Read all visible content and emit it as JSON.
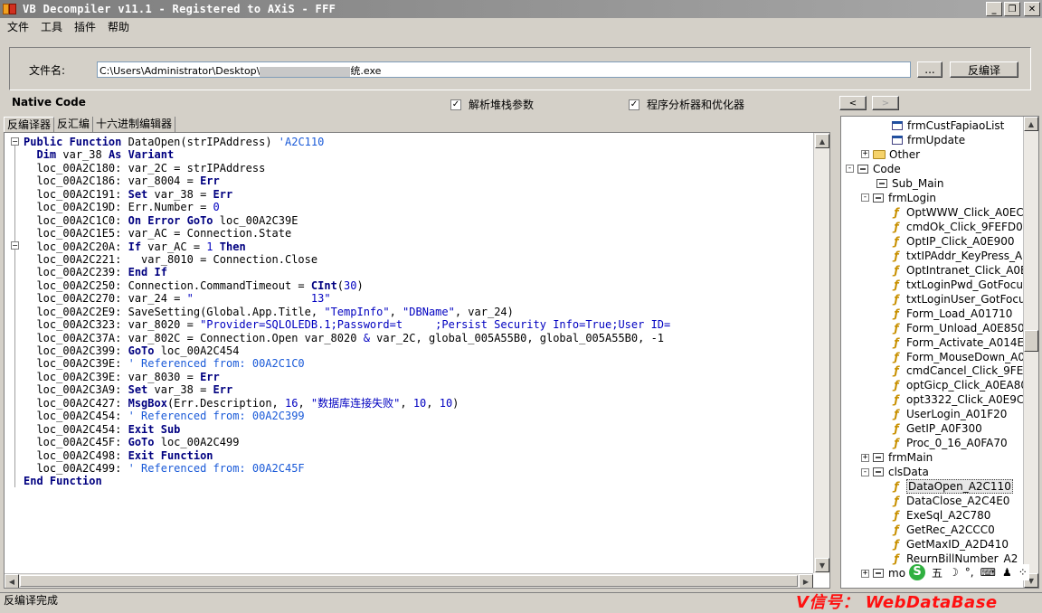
{
  "window": {
    "title": "VB Decompiler v11.1 - Registered to AXiS - FFF",
    "minimize": "_",
    "restore": "❐",
    "close": "✕"
  },
  "menu": [
    "文件",
    "工具",
    "插件",
    "帮助"
  ],
  "file": {
    "label": "文件名:",
    "path_prefix": "C:\\Users\\Administrator\\Desktop\\",
    "path_suffix": "统.exe",
    "browse_label": "...",
    "decompile_label": "反编译"
  },
  "options": {
    "native_label": "Native Code",
    "checkbox1": {
      "label": "解析堆栈参数",
      "checked": true
    },
    "checkbox2": {
      "label": "程序分析器和优化器",
      "checked": true
    },
    "back_label": "<",
    "forward_label": ">"
  },
  "tabs": [
    "反编译器",
    "反汇编",
    "十六进制编辑器"
  ],
  "code_lines": [
    [
      {
        "t": "Public Function",
        "c": "kw"
      },
      {
        "t": " DataOpen(strIPAddress) "
      },
      {
        "t": "'A2C110",
        "c": "cm"
      }
    ],
    [
      {
        "t": "  "
      },
      {
        "t": "Dim",
        "c": "kw"
      },
      {
        "t": " var_38 "
      },
      {
        "t": "As Variant",
        "c": "kw"
      }
    ],
    [
      {
        "t": "  loc_00A2C180: var_2C = strIPAddress"
      }
    ],
    [
      {
        "t": "  loc_00A2C186: var_8004 = "
      },
      {
        "t": "Err",
        "c": "kw"
      }
    ],
    [
      {
        "t": "  loc_00A2C191: "
      },
      {
        "t": "Set",
        "c": "kw"
      },
      {
        "t": " var_38 = "
      },
      {
        "t": "Err",
        "c": "kw"
      }
    ],
    [
      {
        "t": "  loc_00A2C19D: Err.Number = "
      },
      {
        "t": "0",
        "c": "str"
      }
    ],
    [
      {
        "t": "  loc_00A2C1C0: "
      },
      {
        "t": "On Error GoTo",
        "c": "kw"
      },
      {
        "t": " loc_00A2C39E"
      }
    ],
    [
      {
        "t": "  loc_00A2C1E5: var_AC = Connection.State"
      }
    ],
    [
      {
        "t": "  loc_00A2C20A: "
      },
      {
        "t": "If",
        "c": "kw"
      },
      {
        "t": " var_AC = "
      },
      {
        "t": "1",
        "c": "str"
      },
      {
        "t": " "
      },
      {
        "t": "Then",
        "c": "kw"
      }
    ],
    [
      {
        "t": "  loc_00A2C221:   var_8010 = Connection.Close"
      }
    ],
    [
      {
        "t": "  loc_00A2C239: "
      },
      {
        "t": "End If",
        "c": "kw"
      }
    ],
    [
      {
        "t": "  loc_00A2C250: Connection.CommandTimeout = "
      },
      {
        "t": "CInt",
        "c": "kw"
      },
      {
        "t": "("
      },
      {
        "t": "30",
        "c": "str"
      },
      {
        "t": ")"
      }
    ],
    [
      {
        "t": "  loc_00A2C270: var_24 = "
      },
      {
        "t": "\"                  13\"",
        "c": "str"
      }
    ],
    [
      {
        "t": "  loc_00A2C2E9: SaveSetting(Global.App.Title, "
      },
      {
        "t": "\"TempInfo\"",
        "c": "str"
      },
      {
        "t": ", "
      },
      {
        "t": "\"DBName\"",
        "c": "str"
      },
      {
        "t": ", var_24)"
      }
    ],
    [
      {
        "t": "  loc_00A2C323: var_8020 = "
      },
      {
        "t": "\"Provider=SQLOLEDB.1;Password=t     ;Persist Security Info=True;User ID=",
        "c": "str"
      }
    ],
    [
      {
        "t": "  loc_00A2C37A: var_802C = Connection.Open var_8020 "
      },
      {
        "t": "&",
        "c": "str"
      },
      {
        "t": " var_2C, global_005A55B0, global_005A55B0, -1"
      }
    ],
    [
      {
        "t": "  loc_00A2C399: "
      },
      {
        "t": "GoTo",
        "c": "kw"
      },
      {
        "t": " loc_00A2C454"
      }
    ],
    [
      {
        "t": "  loc_00A2C39E: "
      },
      {
        "t": "' Referenced from: 00A2C1C0",
        "c": "cm"
      }
    ],
    [
      {
        "t": "  loc_00A2C39E: var_8030 = "
      },
      {
        "t": "Err",
        "c": "kw"
      }
    ],
    [
      {
        "t": "  loc_00A2C3A9: "
      },
      {
        "t": "Set",
        "c": "kw"
      },
      {
        "t": " var_38 = "
      },
      {
        "t": "Err",
        "c": "kw"
      }
    ],
    [
      {
        "t": "  loc_00A2C427: "
      },
      {
        "t": "MsgBox",
        "c": "kw"
      },
      {
        "t": "(Err.Description, "
      },
      {
        "t": "16",
        "c": "str"
      },
      {
        "t": ", "
      },
      {
        "t": "\"数据库连接失败\"",
        "c": "str"
      },
      {
        "t": ", "
      },
      {
        "t": "10",
        "c": "str"
      },
      {
        "t": ", "
      },
      {
        "t": "10",
        "c": "str"
      },
      {
        "t": ")"
      }
    ],
    [
      {
        "t": "  loc_00A2C454: "
      },
      {
        "t": "' Referenced from: 00A2C399",
        "c": "cm"
      }
    ],
    [
      {
        "t": "  loc_00A2C454: "
      },
      {
        "t": "Exit Sub",
        "c": "kw"
      }
    ],
    [
      {
        "t": "  loc_00A2C45F: "
      },
      {
        "t": "GoTo",
        "c": "kw"
      },
      {
        "t": " loc_00A2C499"
      }
    ],
    [
      {
        "t": "  loc_00A2C498: "
      },
      {
        "t": "Exit Function",
        "c": "kw"
      }
    ],
    [
      {
        "t": "  loc_00A2C499: "
      },
      {
        "t": "' Referenced from: 00A2C45F",
        "c": "cm"
      }
    ],
    [
      {
        "t": "End Function",
        "c": "kw"
      }
    ]
  ],
  "tree": [
    {
      "label": "frmCustFapiaoList",
      "indent": 3,
      "icon": "form"
    },
    {
      "label": "frmUpdate",
      "indent": 3,
      "icon": "form"
    },
    {
      "label": "Other",
      "indent": 1,
      "icon": "folder",
      "expander": "+"
    },
    {
      "label": "Code",
      "indent": 0,
      "icon": "code",
      "expander": "-"
    },
    {
      "label": "Sub_Main",
      "indent": 2,
      "icon": "code"
    },
    {
      "label": "frmLogin",
      "indent": 1,
      "icon": "code",
      "expander": "-"
    },
    {
      "label": "OptWWW_Click_A0EC",
      "indent": 3,
      "icon": "func"
    },
    {
      "label": "cmdOk_Click_9FEFD0",
      "indent": 3,
      "icon": "func"
    },
    {
      "label": "OptIP_Click_A0E900",
      "indent": 3,
      "icon": "func"
    },
    {
      "label": "txtIPAddr_KeyPress_A0",
      "indent": 3,
      "icon": "func"
    },
    {
      "label": "OptIntranet_Click_A0E",
      "indent": 3,
      "icon": "func"
    },
    {
      "label": "txtLoginPwd_GotFocu",
      "indent": 3,
      "icon": "func"
    },
    {
      "label": "txtLoginUser_GotFocu",
      "indent": 3,
      "icon": "func"
    },
    {
      "label": "Form_Load_A01710",
      "indent": 3,
      "icon": "func"
    },
    {
      "label": "Form_Unload_A0E850",
      "indent": 3,
      "icon": "func"
    },
    {
      "label": "Form_Activate_A014E",
      "indent": 3,
      "icon": "func"
    },
    {
      "label": "Form_MouseDown_A0",
      "indent": 3,
      "icon": "func"
    },
    {
      "label": "cmdCancel_Click_9FEE",
      "indent": 3,
      "icon": "func"
    },
    {
      "label": "optGicp_Click_A0EA80",
      "indent": 3,
      "icon": "func"
    },
    {
      "label": "opt3322_Click_A0E9C0",
      "indent": 3,
      "icon": "func"
    },
    {
      "label": "UserLogin_A01F20",
      "indent": 3,
      "icon": "func"
    },
    {
      "label": "GetIP_A0F300",
      "indent": 3,
      "icon": "func"
    },
    {
      "label": "Proc_0_16_A0FA70",
      "indent": 3,
      "icon": "func"
    },
    {
      "label": "frmMain",
      "indent": 1,
      "icon": "code",
      "expander": "+"
    },
    {
      "label": "clsData",
      "indent": 1,
      "icon": "code",
      "expander": "-"
    },
    {
      "label": "DataOpen_A2C110",
      "indent": 3,
      "icon": "func",
      "selected": true
    },
    {
      "label": "DataClose_A2C4E0",
      "indent": 3,
      "icon": "func"
    },
    {
      "label": "ExeSql_A2C780",
      "indent": 3,
      "icon": "func"
    },
    {
      "label": "GetRec_A2CCC0",
      "indent": 3,
      "icon": "func"
    },
    {
      "label": "GetMaxID_A2D410",
      "indent": 3,
      "icon": "func"
    },
    {
      "label": "ReurnBillNumber_A2",
      "indent": 3,
      "icon": "func"
    },
    {
      "label": "mo",
      "indent": 1,
      "icon": "code",
      "expander": "+"
    }
  ],
  "status": "反编译完成",
  "watermark": "V信号：  WebDataBase",
  "ime": {
    "logo": "S",
    "mode": "五"
  }
}
